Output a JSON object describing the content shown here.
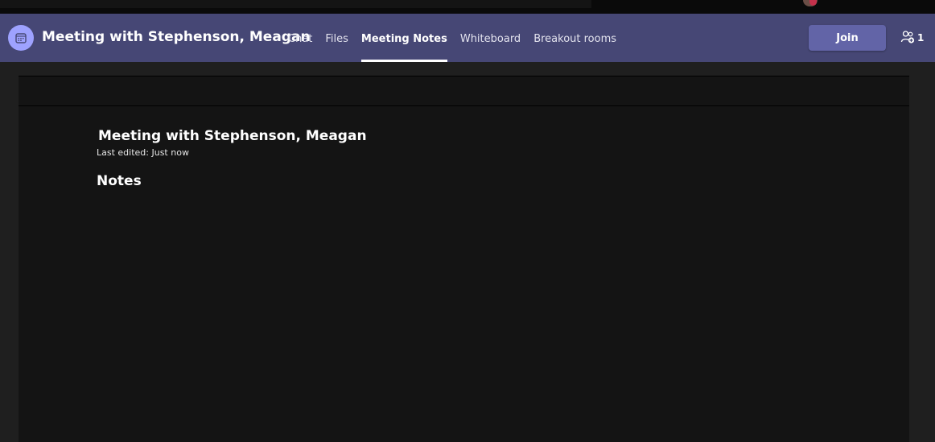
{
  "header": {
    "title": "Meeting with Stephenson, Meagan",
    "meeting_icon": "calendar-icon",
    "tabs": [
      {
        "label": "Chat",
        "active": false
      },
      {
        "label": "Files",
        "active": false
      },
      {
        "label": "Meeting Notes",
        "active": true
      },
      {
        "label": "Whiteboard",
        "active": false
      },
      {
        "label": "Breakout rooms",
        "active": false
      }
    ],
    "join_label": "Join",
    "participants_icon": "people-icon",
    "participants_count": "1"
  },
  "document": {
    "title": "Meeting with Stephenson, Meagan",
    "last_edited": "Last edited: Just now",
    "section_heading": "Notes"
  },
  "colors": {
    "header_bg": "#464775",
    "accent": "#6264a7",
    "icon_bg": "#9ea2ff",
    "content_bg": "#141414"
  }
}
